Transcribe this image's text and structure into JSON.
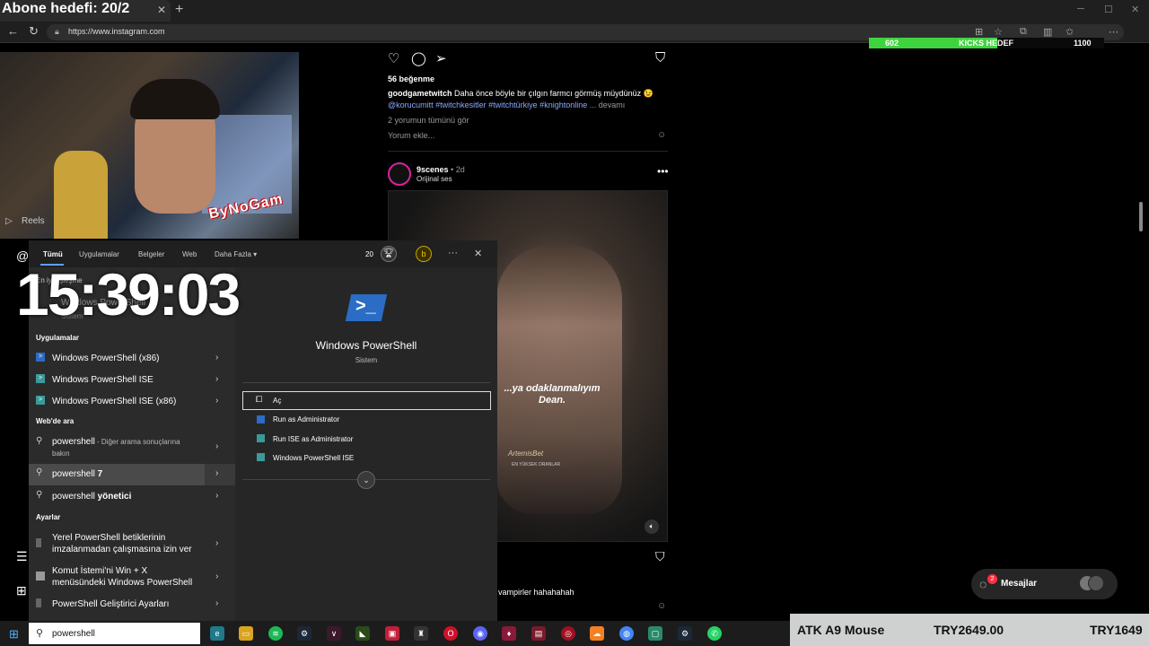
{
  "browser": {
    "tab_title": "Abone hedefi: 20/2",
    "tab_close": "✕",
    "new_tab": "+",
    "url": "https://www.instagram.com"
  },
  "kicks": {
    "current": "602",
    "label": "KICKS HEDEF",
    "target": "1100",
    "progress": 0.547,
    "color": "#3fd43f"
  },
  "webcam": {
    "logo": "ByNoGam",
    "reels_label": "Reels"
  },
  "post1": {
    "likes": "56 beğenme",
    "username": "goodgametwitch",
    "caption": "Daha önce böyle bir çılgın farmcı görmüş müydünüz 😉",
    "hashtags": "@korucumitt #twitchkesitler #twitchtürkiye #knightonline",
    "more": "... devamı",
    "comments_link": "2 yorumun tümünü gör",
    "comment_placeholder": "Yorum ekle..."
  },
  "post2": {
    "username": "9scenes",
    "time": "• 2d",
    "audio": "Orijinal ses",
    "subtitle": "...ya odaklanmalıyım Dean.",
    "watermark": "ArtemisBet",
    "watermark_sub": "EN YÜKSEK ORANLAR",
    "caption": "vampirler hahahahah"
  },
  "messages": {
    "label": "Mesajlar",
    "badge": "2"
  },
  "start_menu": {
    "tabs": [
      "Tümü",
      "Uygulamalar",
      "Belgeler",
      "Web",
      "Daha Fazla ▾"
    ],
    "points": "20",
    "clock": "15:39:03",
    "best_match_label": "En iyi eşleşme",
    "best_match_title": "Windows PowerShell",
    "best_match_sub": "Sistem",
    "sections": {
      "apps": "Uygulamalar",
      "web": "Web'de ara",
      "settings": "Ayarlar"
    },
    "apps": [
      "Windows PowerShell (x86)",
      "Windows PowerShell ISE",
      "Windows PowerShell ISE (x86)"
    ],
    "web": [
      {
        "query": "powershell",
        "suffix": " - Diğer arama sonuçlarına",
        "suffix2": "bakın"
      },
      {
        "query": "powershell ",
        "bold": "7"
      },
      {
        "query": "powershell ",
        "bold": "yönetici"
      }
    ],
    "settings": [
      {
        "line1": "Yerel PowerShell betiklerinin",
        "line2": "imzalanmadan çalışmasına izin ver"
      },
      {
        "line1": "Komut İstemi'ni Win + X",
        "line2": "menüsündeki Windows PowerShell"
      },
      {
        "line1": "PowerShell Geliştirici Ayarları",
        "line2": ""
      }
    ],
    "preview_title": "Windows PowerShell",
    "preview_sub": "Sistem",
    "actions": [
      "Aç",
      "Run as Administrator",
      "Run ISE as Administrator",
      "Windows PowerShell ISE"
    ]
  },
  "taskbar": {
    "search_text": "powershell"
  },
  "ticker": {
    "item": "ATK A9 Mouse",
    "price1": "TRY2649.00",
    "price2": "TRY1649"
  }
}
